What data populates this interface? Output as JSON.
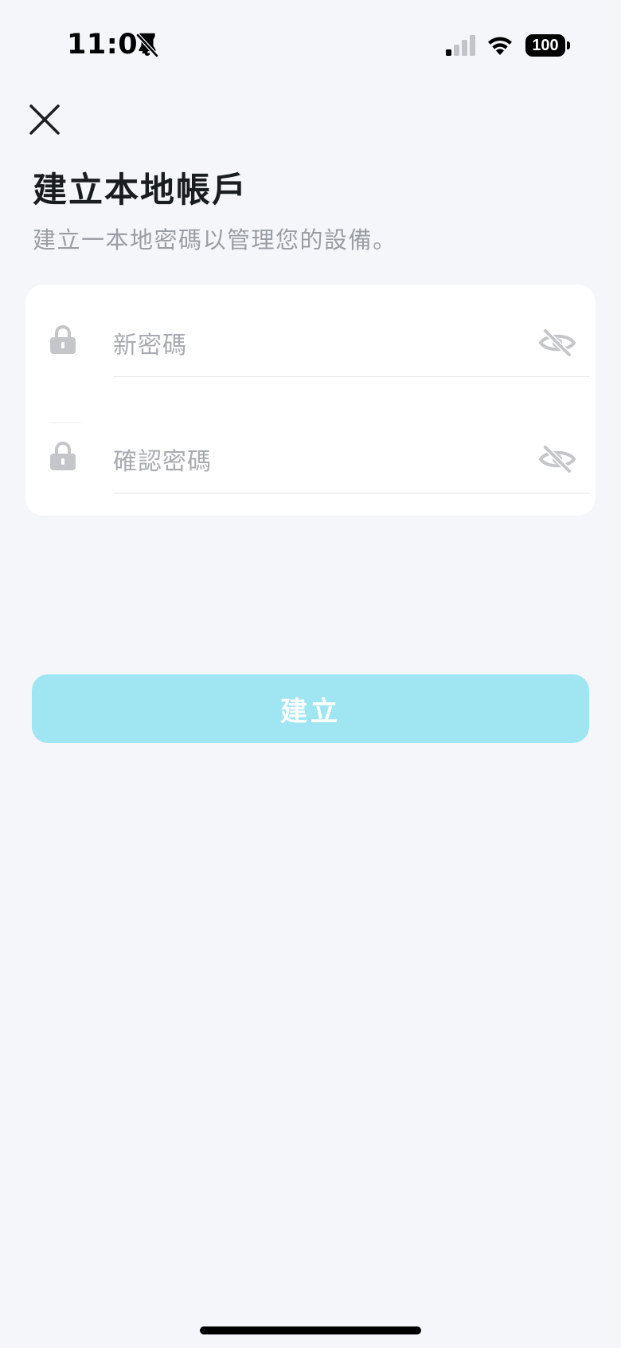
{
  "status_bar": {
    "time": "11:07",
    "battery_level": "100",
    "icons": [
      "bell-off-icon",
      "signal-icon",
      "wifi-icon",
      "battery-icon"
    ]
  },
  "header": {
    "close_icon": "close-icon",
    "title": "建立本地帳戶",
    "subtitle": "建立一本地密碼以管理您的設備。"
  },
  "form": {
    "new_password": {
      "placeholder": "新密碼",
      "value": "",
      "icon": "lock-icon",
      "toggle_icon": "eye-off-icon"
    },
    "confirm_password": {
      "placeholder": "確認密碼",
      "value": "",
      "icon": "lock-icon",
      "toggle_icon": "eye-off-icon"
    }
  },
  "actions": {
    "create_label": "建立"
  },
  "colors": {
    "background": "#f4f6fa",
    "card": "#ffffff",
    "button_disabled": "#a0e6f2",
    "placeholder": "#a8abb0",
    "icon_gray": "#c4c6ca"
  }
}
